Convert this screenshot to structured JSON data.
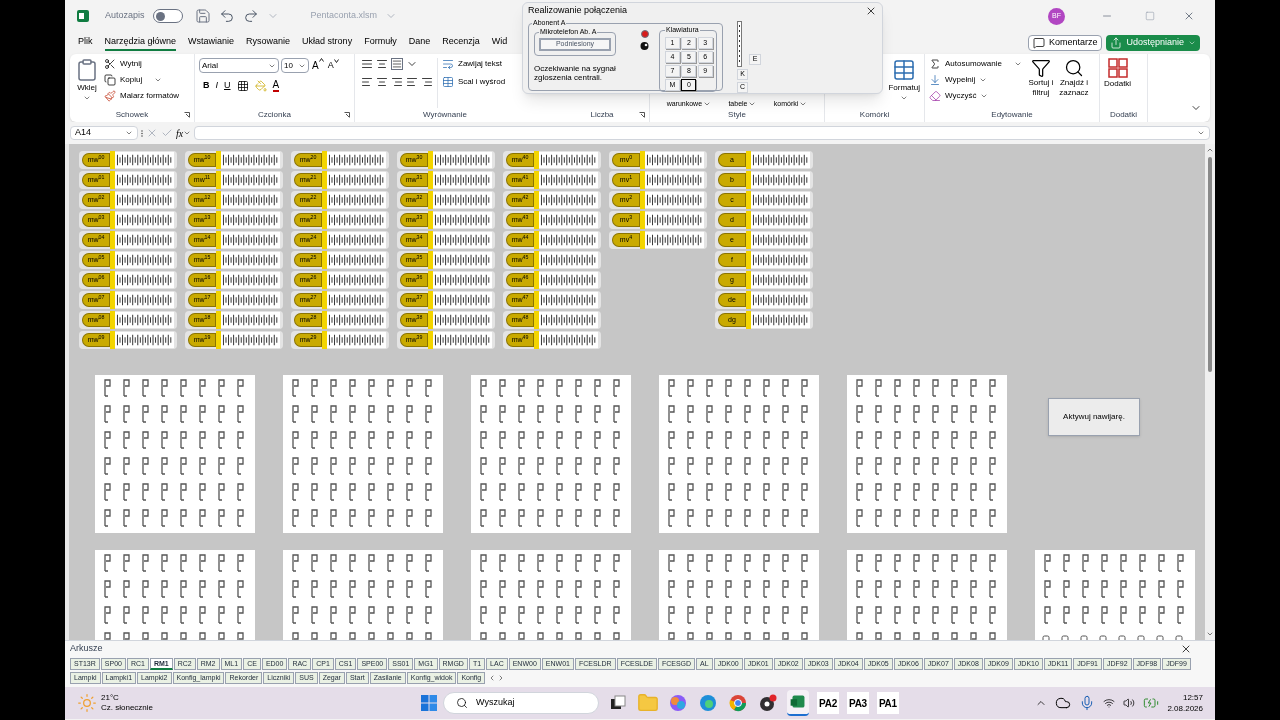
{
  "titlebar": {
    "autosave_label": "Autozapis",
    "autosave_on": false,
    "filename": "Pentaconta.xlsm",
    "user": "BF"
  },
  "tabs": [
    {
      "label": "Plik",
      "selected": false
    },
    {
      "label": "Narzędzia główne",
      "selected": true
    },
    {
      "label": "Wstawianie",
      "selected": false
    },
    {
      "label": "Rysowanie",
      "selected": false
    },
    {
      "label": "Układ strony",
      "selected": false
    },
    {
      "label": "Formuły",
      "selected": false
    },
    {
      "label": "Dane",
      "selected": false
    },
    {
      "label": "Recenzja",
      "selected": false
    },
    {
      "label": "Wid",
      "selected": false
    }
  ],
  "comments_button": "Komentarze",
  "share_button": "Udostępnianie",
  "ribbon": {
    "clipboard": {
      "paste": "Wklej",
      "cut": "Wytnij",
      "copy": "Kopiuj",
      "painter": "Malarz formatów",
      "label": "Schowek"
    },
    "font": {
      "family": "Arial",
      "size": "10",
      "grow": "A",
      "shrink": "A",
      "bold": "B",
      "italic": "I",
      "underline": "U",
      "font_color_letter": "A",
      "label": "Czcionka"
    },
    "alignment": {
      "wrap": "Zawijaj tekst",
      "merge": "Scal i wyśrod",
      "label": "Wyrównanie"
    },
    "number": {
      "label": "Liczba"
    },
    "styles": {
      "items": [
        "warunkowe",
        "tabele",
        "komórki"
      ],
      "label": "Style"
    },
    "cells": {
      "format": "Formatuj",
      "label": "Komórki"
    },
    "editing": {
      "autosum": "Autosumowanie",
      "fill": "Wypełnij",
      "clear": "Wyczyść",
      "sort": "Sortuj i filtruj",
      "find": "Znajdź i zaznacz",
      "label": "Edytowanie"
    },
    "addins": {
      "button": "Dodatki",
      "label": "Dodatki"
    }
  },
  "formula_bar": {
    "name_box": "A14",
    "fx": "fx"
  },
  "dialog": {
    "title": "Realizowanie połączenia",
    "group": "Abonent A",
    "handset_group": "Mikrotelefon Ab. A",
    "handset_state": "Podniesiony",
    "lamp_on": true,
    "message": "Oczekiwanie na sygnał zgloszenia centrali.",
    "keypad_title": "Klawiatura",
    "keys": [
      {
        "label": "1",
        "focused": false
      },
      {
        "label": "2",
        "focused": false
      },
      {
        "label": "3",
        "focused": false
      },
      {
        "label": "4",
        "focused": false
      },
      {
        "label": "5",
        "focused": false
      },
      {
        "label": "6",
        "focused": false
      },
      {
        "label": "7",
        "focused": false
      },
      {
        "label": "8",
        "focused": false
      },
      {
        "label": "9",
        "focused": false
      },
      {
        "label": "M",
        "focused": false
      },
      {
        "label": "0",
        "focused": true
      }
    ],
    "side_buttons": [
      "E",
      "K",
      "C"
    ]
  },
  "blocks": [
    {
      "labels": [
        "mw$^{00}$",
        "mw$^{01}$",
        "mw$^{02}$",
        "mw$^{03}$",
        "mw$^{04}$",
        "mw$^{05}$",
        "mw$^{06}$",
        "mw$^{07}$",
        "mw$^{08}$",
        "mw$^{09}$"
      ]
    },
    {
      "labels": [
        "mw$^{10}$",
        "mw$^{11}$",
        "mw$^{12}$",
        "mw$^{13}$",
        "mw$^{14}$",
        "mw$^{15}$",
        "mw$^{16}$",
        "mw$^{17}$",
        "mw$^{18}$",
        "mw$^{19}$"
      ]
    },
    {
      "labels": [
        "mw$^{20}$",
        "mw$^{21}$",
        "mw$^{22}$",
        "mw$^{23}$",
        "mw$^{24}$",
        "mw$^{25}$",
        "mw$^{26}$",
        "mw$^{27}$",
        "mw$^{28}$",
        "mw$^{29}$"
      ]
    },
    {
      "labels": [
        "mw$^{30}$",
        "mw$^{31}$",
        "mw$^{32}$",
        "mw$^{33}$",
        "mw$^{34}$",
        "mw$^{35}$",
        "mw$^{36}$",
        "mw$^{37}$",
        "mw$^{38}$",
        "mw$^{39}$"
      ]
    },
    {
      "labels": [
        "mw$^{40}$",
        "mw$^{41}$",
        "mw$^{42}$",
        "mw$^{43}$",
        "mw$^{44}$",
        "mw$^{45}$",
        "mw$^{46}$",
        "mw$^{47}$",
        "mw$^{48}$",
        "mw$^{49}$"
      ]
    },
    {
      "labels": [
        "mv$^{0}$",
        "mv$^{1}$",
        "mv$^{2}$",
        "mv$^{3}$",
        "mv$^{4}$"
      ]
    },
    {
      "labels": [
        "a",
        "b",
        "c",
        "d",
        "e",
        "f",
        "g",
        "de",
        "dg"
      ]
    }
  ],
  "panels": [
    {
      "kind": "hooks"
    },
    {
      "kind": "hooks"
    },
    {
      "kind": "hooks"
    },
    {
      "kind": "hooks"
    },
    {
      "kind": "hooks"
    },
    {
      "kind": "none"
    },
    {
      "kind": "hooks"
    },
    {
      "kind": "hooks"
    },
    {
      "kind": "hooks"
    },
    {
      "kind": "hooks"
    },
    {
      "kind": "hooks"
    },
    {
      "kind": "mixed"
    }
  ],
  "activate_button": "Aktywuj nawijarę.",
  "sheets": {
    "title": "Arkusze",
    "tabs": [
      {
        "label": "ST13R",
        "selected": false
      },
      {
        "label": "SP00",
        "selected": false
      },
      {
        "label": "RC1",
        "selected": false
      },
      {
        "label": "RM1",
        "selected": true
      },
      {
        "label": "RC2",
        "selected": false
      },
      {
        "label": "RM2",
        "selected": false
      },
      {
        "label": "ML1",
        "selected": false
      },
      {
        "label": "CE",
        "selected": false
      },
      {
        "label": "ED00",
        "selected": false
      },
      {
        "label": "RAC",
        "selected": false
      },
      {
        "label": "CP1",
        "selected": false
      },
      {
        "label": "CS1",
        "selected": false
      },
      {
        "label": "SPE00",
        "selected": false
      },
      {
        "label": "SS01",
        "selected": false
      },
      {
        "label": "MG1",
        "selected": false
      },
      {
        "label": "RMGD",
        "selected": false
      },
      {
        "label": "T1",
        "selected": false
      },
      {
        "label": "LAC",
        "selected": false
      },
      {
        "label": "ENW00",
        "selected": false
      },
      {
        "label": "ENW01",
        "selected": false
      },
      {
        "label": "FCESLDR",
        "selected": false
      },
      {
        "label": "FCESLDE",
        "selected": false
      },
      {
        "label": "FCESGD",
        "selected": false
      },
      {
        "label": "AL",
        "selected": false
      },
      {
        "label": "JDK00",
        "selected": false
      },
      {
        "label": "JDK01",
        "selected": false
      },
      {
        "label": "JDK02",
        "selected": false
      },
      {
        "label": "JDK03",
        "selected": false
      },
      {
        "label": "JDK04",
        "selected": false
      },
      {
        "label": "JDK05",
        "selected": false
      },
      {
        "label": "JDK06",
        "selected": false
      },
      {
        "label": "JDK07",
        "selected": false
      },
      {
        "label": "JDK08",
        "selected": false
      },
      {
        "label": "JDK09",
        "selected": false
      },
      {
        "label": "JDK10",
        "selected": false
      },
      {
        "label": "JDK11",
        "selected": false
      },
      {
        "label": "JDF91",
        "selected": false
      },
      {
        "label": "JDF92",
        "selected": false
      },
      {
        "label": "JDF98",
        "selected": false
      },
      {
        "label": "JDF99",
        "selected": false
      },
      {
        "label": "Lampki",
        "selected": false
      },
      {
        "label": "Lampki1",
        "selected": false
      },
      {
        "label": "Lampki2",
        "selected": false
      },
      {
        "label": "Konfig_lampki",
        "selected": false
      },
      {
        "label": "Rekorder",
        "selected": false
      },
      {
        "label": "Liczniki",
        "selected": false
      },
      {
        "label": "SUS",
        "selected": false
      },
      {
        "label": "Zegar",
        "selected": false
      },
      {
        "label": "Start",
        "selected": false
      },
      {
        "label": "Zasilanie",
        "selected": false
      },
      {
        "label": "Konfig_widok",
        "selected": false
      },
      {
        "label": "Konfig",
        "selected": false
      }
    ]
  },
  "taskbar": {
    "temperature": "21°C",
    "weather": "Cz. słonecznie",
    "search_placeholder": "Wyszukaj",
    "text_apps": [
      "PA2",
      "PA3",
      "PA1"
    ],
    "time": "12:57",
    "date": "2.08.2026"
  }
}
